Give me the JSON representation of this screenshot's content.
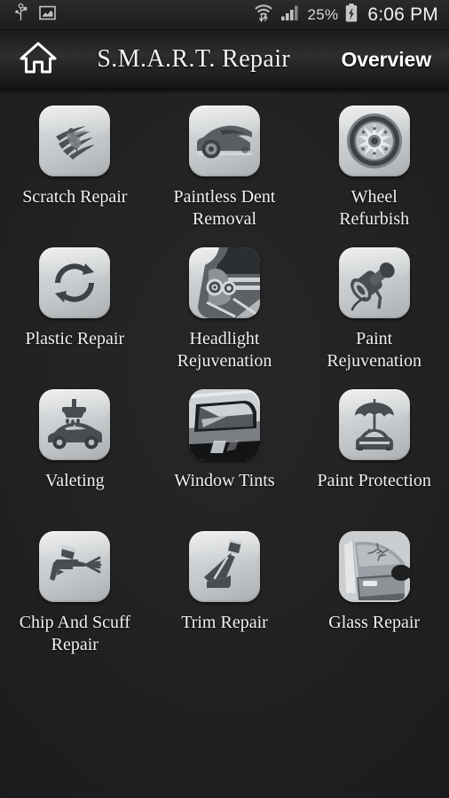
{
  "status_bar": {
    "left_icons": [
      "usb-icon",
      "screenshot-icon"
    ],
    "wifi_icon": "wifi-updown-icon",
    "signal_icon": "cellular-signal-icon",
    "battery_percent": "25%",
    "battery_icon": "battery-charging-icon",
    "clock": "6:06 PM"
  },
  "action_bar": {
    "home_icon": "home-icon",
    "title": "S.M.A.R.T. Repair",
    "overview_label": "Overview"
  },
  "grid": {
    "items": [
      {
        "label": "Scratch Repair",
        "icon": "scratch-marks-icon"
      },
      {
        "label": "Paintless Dent\nRemoval",
        "icon": "dented-car-icon"
      },
      {
        "label": "Wheel\nRefurbish",
        "icon": "alloy-wheel-icon"
      },
      {
        "label": "Plastic Repair",
        "icon": "recycle-arrows-icon"
      },
      {
        "label": "Headlight\nRejuvenation",
        "icon": "headlight-icon"
      },
      {
        "label": "Paint\nRejuvenation",
        "icon": "polisher-tool-icon"
      },
      {
        "label": "Valeting",
        "icon": "car-wash-icon"
      },
      {
        "label": "Window Tints",
        "icon": "tinted-window-icon"
      },
      {
        "label": "Paint Protection",
        "icon": "umbrella-car-icon"
      },
      {
        "label": "Chip And Scuff\nRepair",
        "icon": "spray-gun-icon"
      },
      {
        "label": "Trim Repair",
        "icon": "car-seat-icon"
      },
      {
        "label": "Glass Repair",
        "icon": "cracked-door-glass-icon"
      }
    ]
  },
  "colors": {
    "background": "#222222",
    "tile_light": "#e2e4e6",
    "tile_dark": "#acafb1",
    "icon_dark": "#4a4d50",
    "text": "#f0f0f0"
  }
}
